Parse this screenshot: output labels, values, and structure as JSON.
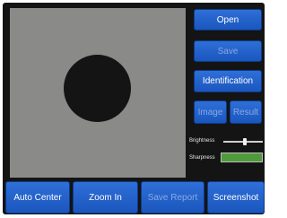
{
  "main": {
    "viewport": {
      "target_shape": "filled-circle"
    }
  },
  "side_panel": {
    "open_label": "Open",
    "save_label": "Save",
    "identification_label": "Identification",
    "image_label": "Image",
    "result_label": "Result",
    "brightness_label": "Brightness",
    "brightness_value": 0.55,
    "sharpness_label": "Sharpness",
    "sharpness_value": 1.0
  },
  "bottom_bar": {
    "auto_center_label": "Auto Center",
    "zoom_in_label": "Zoom In",
    "save_report_label": "Save Report",
    "screenshot_label": "Screenshot"
  },
  "colors": {
    "background": "#141414",
    "button": "#2f6fd8",
    "viewport": "#8a8a89",
    "sharpness_fill": "#4f9a3a",
    "disabled_text": "#8aa9e2"
  }
}
